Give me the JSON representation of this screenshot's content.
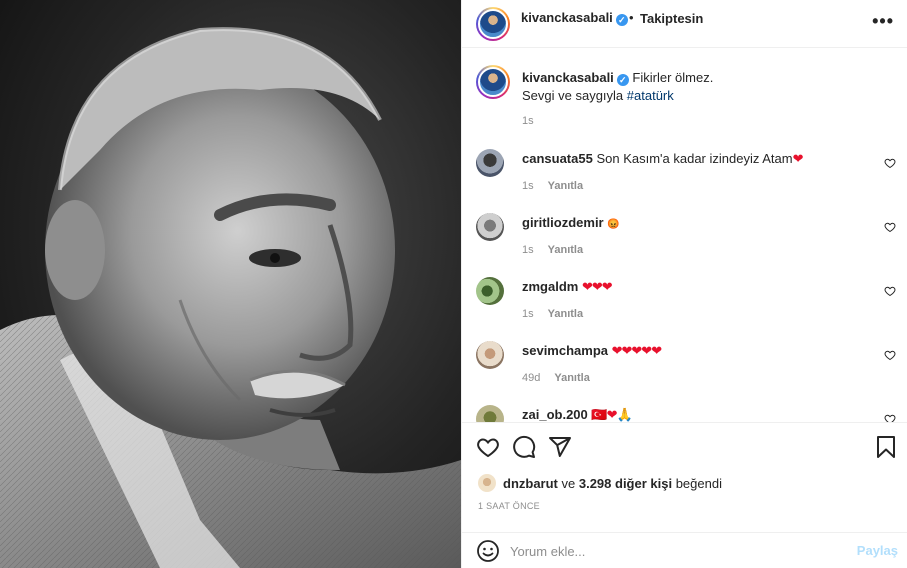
{
  "post": {
    "author": "kivanckasabali",
    "follow_state": "Takiptesin",
    "more": "•••",
    "dot": "•",
    "verified_mark": "✓",
    "caption_line1": "Fikirler ölmez.",
    "caption_line2_prefix": "Sevgi ve saygıyla ",
    "caption_hashtag": "#atatürk",
    "caption_time": "1s"
  },
  "reply_label": "Yanıtla",
  "comments": [
    {
      "user": "cansuata55",
      "text": "Son Kasım'a kadar izindeyiz Atam",
      "emoji": "❤",
      "time": "1s"
    },
    {
      "user": "giritliozdemir",
      "text": "",
      "emoji": "😡",
      "time": "1s"
    },
    {
      "user": "zmgaldm",
      "text": "",
      "emoji": "❤❤❤",
      "time": "1s"
    },
    {
      "user": "sevimchampa",
      "text": "",
      "emoji": "❤❤❤❤❤",
      "time": "49d"
    },
    {
      "user": "zai_ob.200",
      "text": "",
      "emoji": "🇹🇷❤🙏",
      "time": ""
    }
  ],
  "likes": {
    "first_user": "dnzbarut",
    "connector": " ve ",
    "others": "3.298 diğer kişi",
    "suffix": " beğendi"
  },
  "time_ago": "1 SAAT ÖNCE",
  "add_comment": {
    "placeholder": "Yorum ekle...",
    "post_label": "Paylaş"
  },
  "icons": {
    "like": "heart-outline-icon",
    "comment": "speech-bubble-icon",
    "share": "paper-plane-icon",
    "save": "bookmark-icon",
    "emoji": "smiley-icon"
  },
  "colors": {
    "verified": "#3897f0",
    "heart": "#e8112d",
    "hashtag": "#00376b",
    "post_button_disabled": "#b2dffc"
  }
}
